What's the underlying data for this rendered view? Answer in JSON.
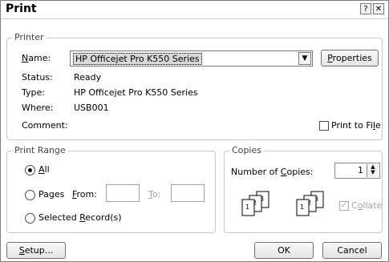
{
  "window": {
    "title": "Print",
    "help_glyph": "?",
    "close_glyph": "✕"
  },
  "printer": {
    "legend": "Printer",
    "name_label": "Name:",
    "name_value": "HP Officejet Pro K550 Series",
    "properties_label": "Properties",
    "status_label": "Status:",
    "status_value": "Ready",
    "type_label": "Type:",
    "type_value": "HP Officejet Pro K550 Series",
    "where_label": "Where:",
    "where_value": "USB001",
    "comment_label": "Comment:",
    "print_to_file_label": "Print to File"
  },
  "print_range": {
    "legend": "Print Range",
    "all_label": "All",
    "pages_label": "Pages",
    "from_label": "From:",
    "to_label": "To:",
    "from_value": "",
    "to_value": "",
    "selected_records_label": "Selected Record(s)",
    "selected": "all"
  },
  "copies": {
    "legend": "Copies",
    "number_label": "Number of Copies:",
    "number_value": "1",
    "collate_label": "Collate",
    "collate_checked": true,
    "stack_labels": [
      "1",
      "2",
      "3"
    ]
  },
  "footer": {
    "setup_label": "Setup...",
    "ok_label": "OK",
    "cancel_label": "Cancel"
  }
}
